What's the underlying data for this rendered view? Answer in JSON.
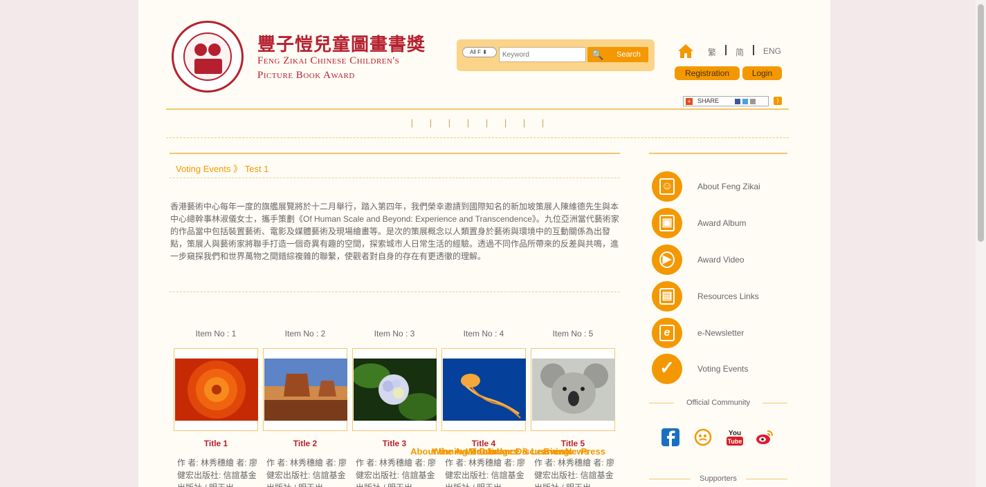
{
  "header": {
    "title_zh": "豐子愷兒童圖畫書獎",
    "title_en_line1": "Feng Zikai Chinese Children's",
    "title_en_line2": "Picture Book Award"
  },
  "search": {
    "scope": "All F",
    "placeholder": "Keyword",
    "button": "Search"
  },
  "languages": [
    "繁",
    "简",
    "ENG"
  ],
  "account": {
    "register": "Registration",
    "login": "Login"
  },
  "share_label": "SHARE",
  "nav": [
    "About the Award",
    "Winning Books",
    "Winners",
    "Judges",
    "Guidance & Learning",
    "Discussion",
    "Events",
    "News",
    "Press"
  ],
  "breadcrumb": {
    "section": "Voting Events",
    "separator": "》",
    "page": "Test 1"
  },
  "intro": "香港藝術中心每年一度的旗艦展覽將於十二月舉行，踏入第四年，我們榮幸邀請到國際知名的新加坡策展人陳維德先生與本中心總幹事林淑儀女士，攜手策劃《Of Human Scale and Beyond: Experience and Transcendence》。九位亞洲當代藝術家的作品當中包括裝置藝術、電影及媒體藝術及現場繪畫等。是次的策展概念以人類置身於藝術與環境中的互動關係為出發點，策展人與藝術家將聯手打造一個奇異有趣的空間，探索城市人日常生活的經驗。透過不同作品所帶來的反差與共鳴，進一步窺探我們和世界萬物之間錯綜複雜的聯繫，使觀者對自身的存在有更透徹的理解。",
  "items": [
    {
      "no": "Item No : 1",
      "title": "Title 1",
      "desc": "作 者: 林秀穗繪 者: 廖健宏出版社: 信誼基金出版社 / 明天出",
      "image": "flower-photo"
    },
    {
      "no": "Item No : 2",
      "title": "Title 2",
      "desc": "作 者: 林秀穗繪 者: 廖健宏出版社: 信誼基金出版社 / 明天出",
      "image": "desert-photo"
    },
    {
      "no": "Item No : 3",
      "title": "Title 3",
      "desc": "作 者: 林秀穗繪 者: 廖健宏出版社: 信誼基金出版社 / 明天出",
      "image": "hydrangea-photo"
    },
    {
      "no": "Item No : 4",
      "title": "Title 4",
      "desc": "作 者: 林秀穗繪 者: 廖健宏出版社: 信誼基金出版社 / 明天出",
      "image": "jellyfish-photo"
    },
    {
      "no": "Item No : 5",
      "title": "Title 5",
      "desc": "作 者: 林秀穗繪 者: 廖健宏出版社: 信誼基金出版社 / 明天出",
      "image": "koala-photo"
    }
  ],
  "sidebar": {
    "links": [
      {
        "label": "About Feng Zikai",
        "icon": "portrait-icon"
      },
      {
        "label": "Award Album",
        "icon": "album-icon"
      },
      {
        "label": "Award Video",
        "icon": "play-icon"
      },
      {
        "label": "Resources Links",
        "icon": "monitor-icon"
      },
      {
        "label": "e-Newsletter",
        "icon": "newsletter-icon"
      },
      {
        "label": "Voting Events",
        "icon": "check-icon"
      }
    ],
    "community_title": "Official Community",
    "social": [
      "facebook-icon",
      "douban-icon",
      "youtube-icon",
      "weibo-icon"
    ],
    "supporters_title": "Supporters"
  },
  "colors": {
    "accent": "#f39800",
    "brand_red": "#b5202e",
    "page_bg": "#fffcf5"
  }
}
